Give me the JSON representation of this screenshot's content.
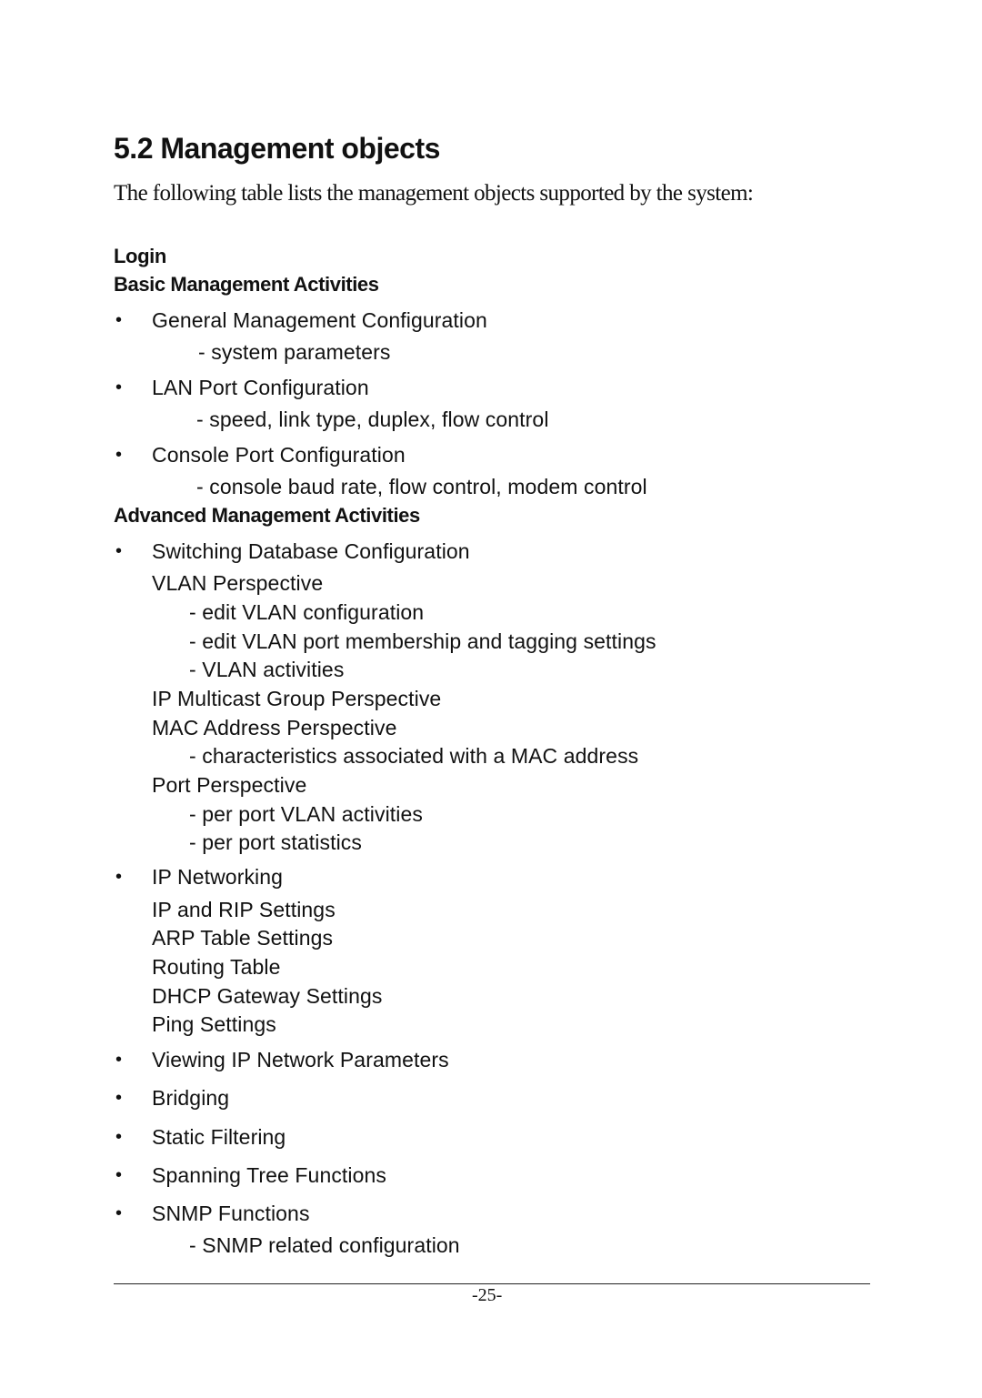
{
  "heading": "5.2 Management objects",
  "intro": "The following table lists the management objects supported by the system:",
  "sections": {
    "login": "Login",
    "basic": "Basic Management Activities",
    "advanced": "Advanced Management Activities"
  },
  "bullet_glyph": "•",
  "basic_items": [
    {
      "label": "General Management Configuration",
      "detail": "- system parameters"
    },
    {
      "label": "LAN Port Configuration",
      "detail": "- speed, link type, duplex, flow control"
    },
    {
      "label": "Console Port Configuration",
      "detail": "- console baud rate, flow control, modem control"
    }
  ],
  "advanced_items": {
    "switching": {
      "label": "Switching Database Configuration",
      "vlan": "VLAN Perspective",
      "vlan_details": [
        "- edit VLAN configuration",
        "- edit VLAN port membership and tagging settings",
        "- VLAN activities"
      ],
      "multicast": "IP Multicast Group Perspective",
      "mac": "MAC Address Perspective",
      "mac_details": [
        "- characteristics associated with a MAC address"
      ],
      "port": "Port Perspective",
      "port_details": [
        "- per port VLAN activities",
        "- per port statistics"
      ]
    },
    "ip": {
      "label": "IP Networking",
      "subitems": [
        "IP and RIP Settings",
        "ARP Table Settings",
        "Routing Table",
        "DHCP Gateway Settings",
        "Ping Settings"
      ]
    },
    "others": [
      "Viewing IP Network Parameters",
      "Bridging",
      "Static Filtering",
      "Spanning Tree Functions",
      "SNMP Functions"
    ],
    "snmp_detail": "- SNMP related configuration"
  },
  "footer": {
    "page_number": "-25-"
  }
}
